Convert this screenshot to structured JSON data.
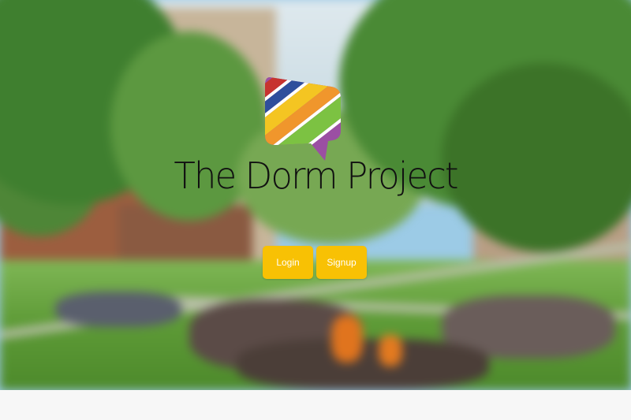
{
  "brand": {
    "name": "The Dorm Project",
    "logo_icon": "speech-bubble-rainbow-stripes-icon",
    "logo_colors": [
      "#c7332f",
      "#2f4e9c",
      "#f4c522",
      "#f0962c",
      "#7cc242",
      "#9b4fa3"
    ]
  },
  "actions": {
    "login_label": "Login",
    "signup_label": "Signup",
    "button_color": "#f8c104"
  },
  "hero": {
    "background": "blurred-campus-quad-photo"
  }
}
